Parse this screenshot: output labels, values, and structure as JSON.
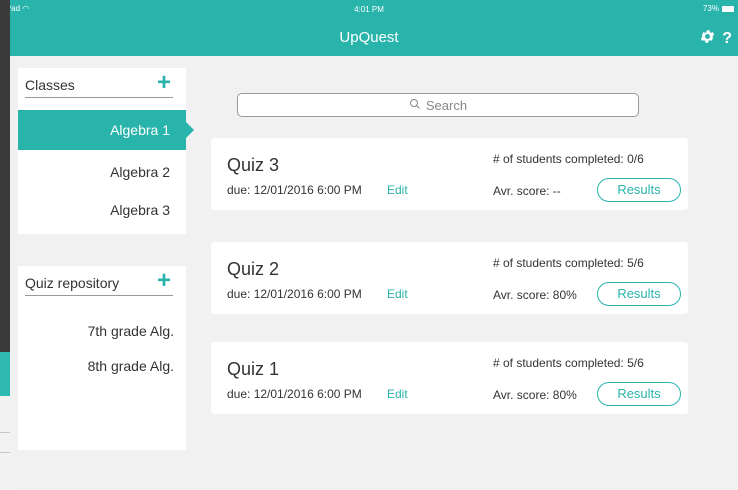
{
  "status_bar": {
    "device": "iPad",
    "time": "4:01 PM",
    "battery": "73%"
  },
  "header": {
    "title": "UpQuest"
  },
  "classes": {
    "title": "Classes",
    "items": [
      {
        "label": "Algebra 1",
        "active": true
      },
      {
        "label": "Algebra 2",
        "active": false
      },
      {
        "label": "Algebra 3",
        "active": false
      }
    ]
  },
  "quiz_repository": {
    "title": "Quiz repository",
    "items": [
      {
        "label": "7th grade Alg."
      },
      {
        "label": "8th grade Alg."
      }
    ]
  },
  "search": {
    "placeholder": "Search"
  },
  "quizzes": [
    {
      "title": "Quiz 3",
      "due": "due: 12/01/2016 6:00 PM",
      "edit": "Edit",
      "completed": "# of students completed: 0/6",
      "score": "Avr. score: --",
      "results": "Results"
    },
    {
      "title": "Quiz 2",
      "due": "due: 12/01/2016 6:00 PM",
      "edit": "Edit",
      "completed": "# of students completed: 5/6",
      "score": "Avr. score: 80%",
      "results": "Results"
    },
    {
      "title": "Quiz 1",
      "due": "due: 12/01/2016 6:00 PM",
      "edit": "Edit",
      "completed": "# of students completed: 5/6",
      "score": "Avr. score: 80%",
      "results": "Results"
    }
  ],
  "colors": {
    "accent": "#28b3ab",
    "background": "#f1f1f1",
    "panel": "#ffffff",
    "text": "#333333"
  }
}
